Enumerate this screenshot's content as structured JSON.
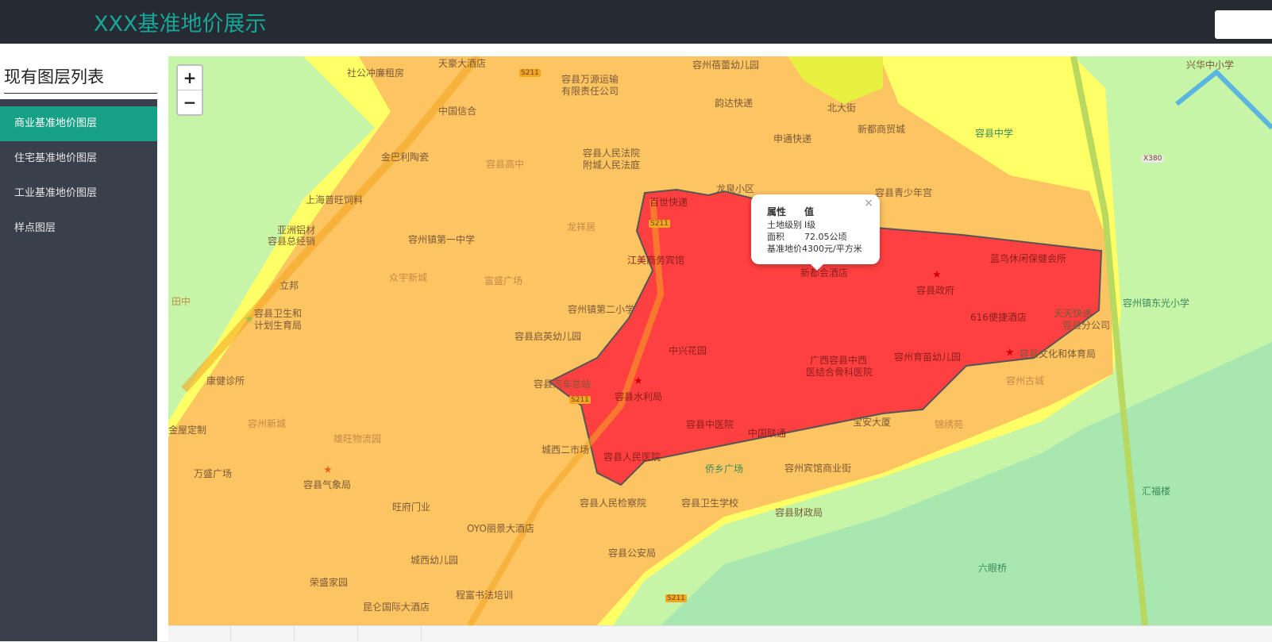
{
  "header": {
    "title": "XXX基准地价展示"
  },
  "sidebar": {
    "title": "现有图层列表",
    "items": [
      {
        "label": "商业基准地价图层",
        "active": true
      },
      {
        "label": "住宅基准地价图层",
        "active": false
      },
      {
        "label": "工业基准地价图层",
        "active": false
      },
      {
        "label": "样点图层",
        "active": false
      }
    ]
  },
  "map": {
    "zoom_in": "+",
    "zoom_out": "−",
    "zone_colors": {
      "grade1": "#ff4040",
      "grade2": "#fdc462",
      "grade3": "#ffff66",
      "outside": "#c6f5a8",
      "river": "#a8e8b0"
    },
    "popup": {
      "head_key": "属性",
      "head_val": "值",
      "close": "×",
      "rows": [
        {
          "key": "土地级别",
          "value": "Ⅰ级"
        },
        {
          "key": "面积",
          "value": "72.05公顷"
        },
        {
          "key": "基准地价",
          "value": "4300元/平方米"
        }
      ]
    },
    "labels": {
      "l1": "天豪大酒店",
      "l2": "容州蓓蕾幼儿园",
      "l3": "社公冲廉租房",
      "l4": "容县万源运输",
      "l5": "有限责任公司",
      "l6": "中国信合",
      "l7": "韵达快递",
      "l8": "北大街",
      "l9": "兴华中小学",
      "l10": "申通快递",
      "l11": "新都商贸城",
      "l12": "容县中学",
      "l13": "金巴利陶瓷",
      "l14": "容县高中",
      "l15": "容县人民法院",
      "l16": "附城人民法庭",
      "l17": "上海普旺饲料",
      "l18": "龙泉小区",
      "l19": "容县青少年宫",
      "l20": "百世快递",
      "l21": "亚洲铝材",
      "l22": "容县总经销",
      "l23": "容州镇第一中学",
      "l24": "龙祥居",
      "l25": "江美商务宾馆",
      "l26": "新都会酒店",
      "l27": "容县政府",
      "l28": "蓝鸟休闲保健会所",
      "l29": "众宇新城",
      "l30": "富盛广场",
      "l31": "立邦",
      "l32": "容州镇第二小学",
      "l33": "616便捷酒店",
      "l34": "天天快递",
      "l35": "容州镇东光小学",
      "l36": "容县卫生和",
      "l37": "计划生育局",
      "l38": "容县启英幼儿园",
      "l39": "中兴花园",
      "l40": "容县分公司",
      "l41": "广西容县中西",
      "l42": "医结合骨科医院",
      "l43": "容州育苗幼儿园",
      "l44": "容县文化和体育局",
      "l45": "康健诊所",
      "l46": "容县汽车总站",
      "l47": "容县水利局",
      "l48": "容州古城",
      "l49": "容州新城",
      "l50": "宝安大厦",
      "l51": "锦绣苑",
      "l52": "金屋定制",
      "l53": "雄旺物流园",
      "l54": "容县中医院",
      "l55": "中国联通",
      "l56": "城西二市场",
      "l57": "容县人民医院",
      "l58": "侨乡广场",
      "l59": "容州宾馆商业街",
      "l60": "万盛广场",
      "l61": "容县气象局",
      "l62": "旺府门业",
      "l63": "容县人民检察院",
      "l64": "容县卫生学校",
      "l65": "容县财政局",
      "l66": "OYO丽景大酒店",
      "l67": "容县公安局",
      "l68": "汇福楼",
      "l69": "城西幼儿园",
      "l70": "荣盛家园",
      "l71": "六眼桥",
      "l72": "程富书法培训",
      "l73": "昆仑国际大酒店",
      "l74": "田中",
      "r1": "S211",
      "r2": "S211",
      "r3": "S211",
      "r4": "S211",
      "r5": "X380"
    }
  }
}
